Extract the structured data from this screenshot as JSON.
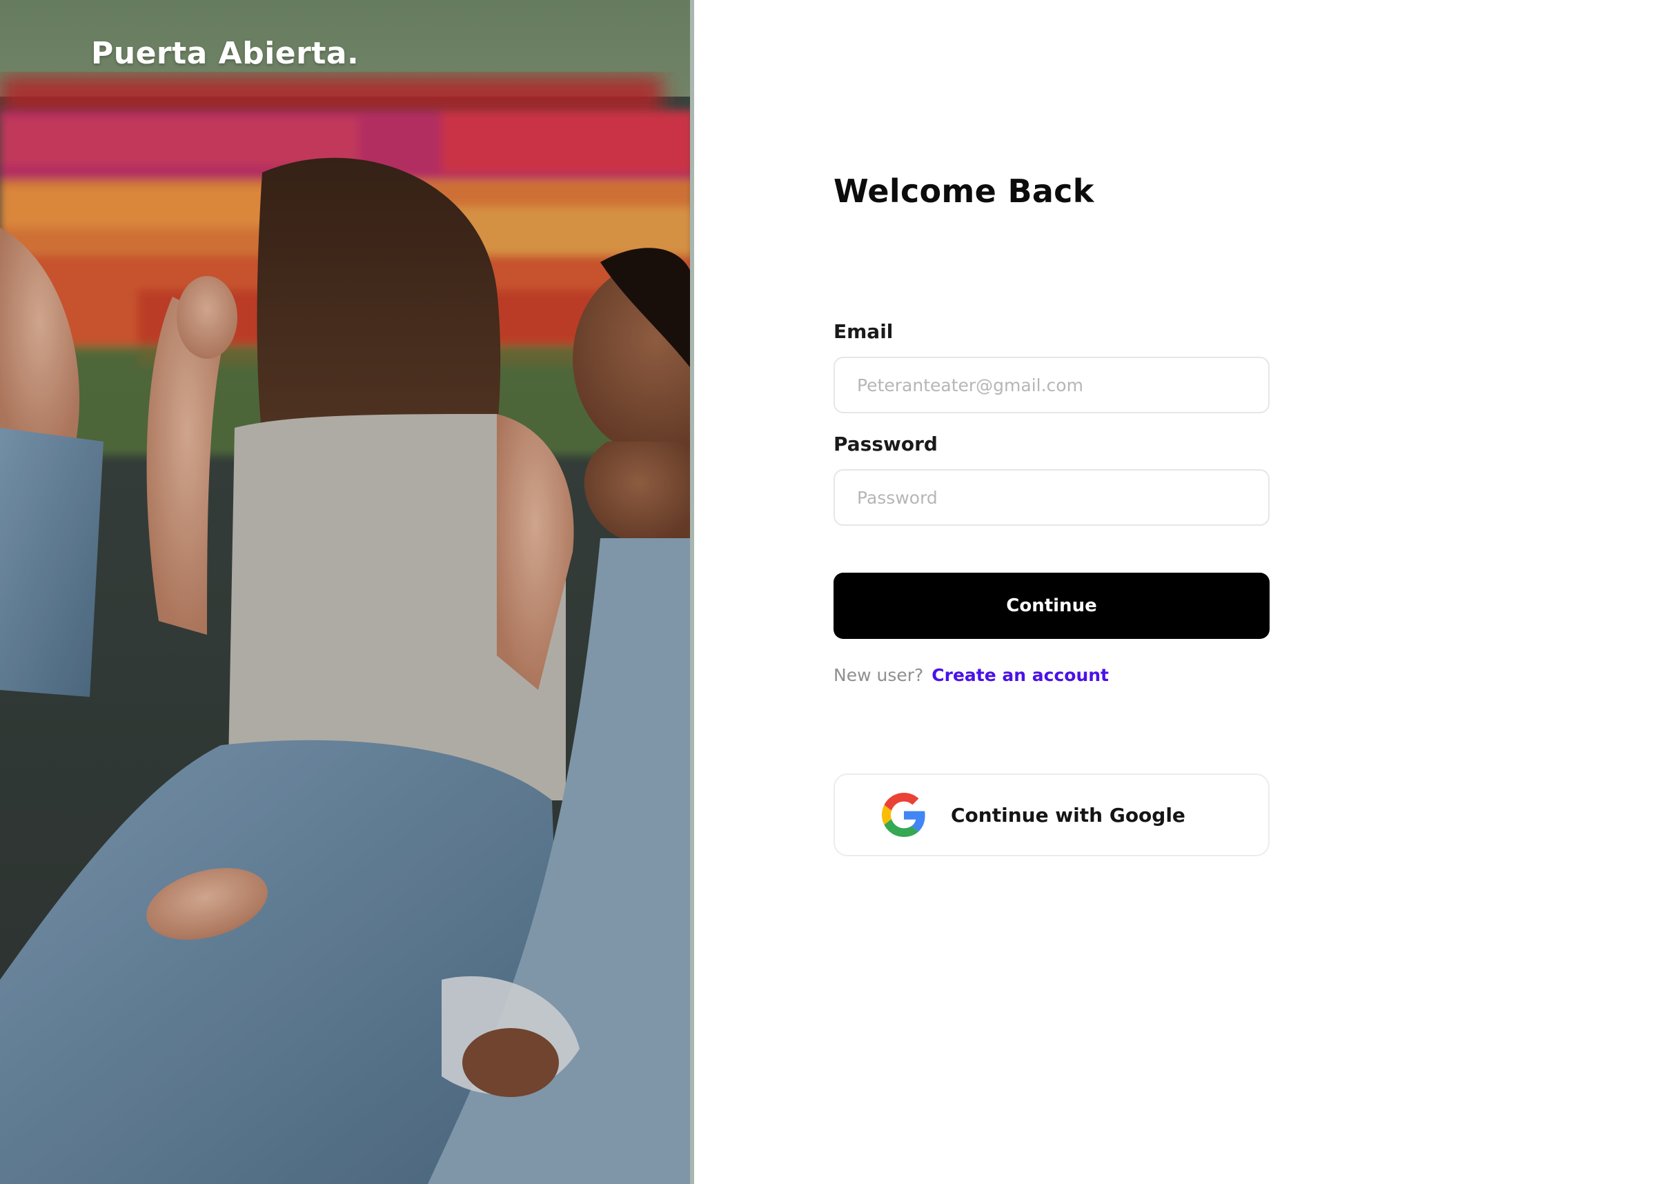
{
  "brand": {
    "name": "Puerta Abierta."
  },
  "hero": {
    "icon": "photo-friends-tulip-field"
  },
  "form": {
    "title": "Welcome Back",
    "email": {
      "label": "Email",
      "placeholder": "Peteranteater@gmail.com",
      "value": ""
    },
    "password": {
      "label": "Password",
      "placeholder": "Password",
      "value": ""
    },
    "continue_label": "Continue",
    "signup_prompt": "New user?",
    "signup_link": "Create an account",
    "google_label": "Continue with Google"
  },
  "colors": {
    "primary_button": "#000000",
    "link": "#4a12e8",
    "input_border": "#e6e6e6",
    "google_blue": "#4285F4",
    "google_red": "#EA4335",
    "google_yellow": "#FBBC05",
    "google_green": "#34A853"
  }
}
